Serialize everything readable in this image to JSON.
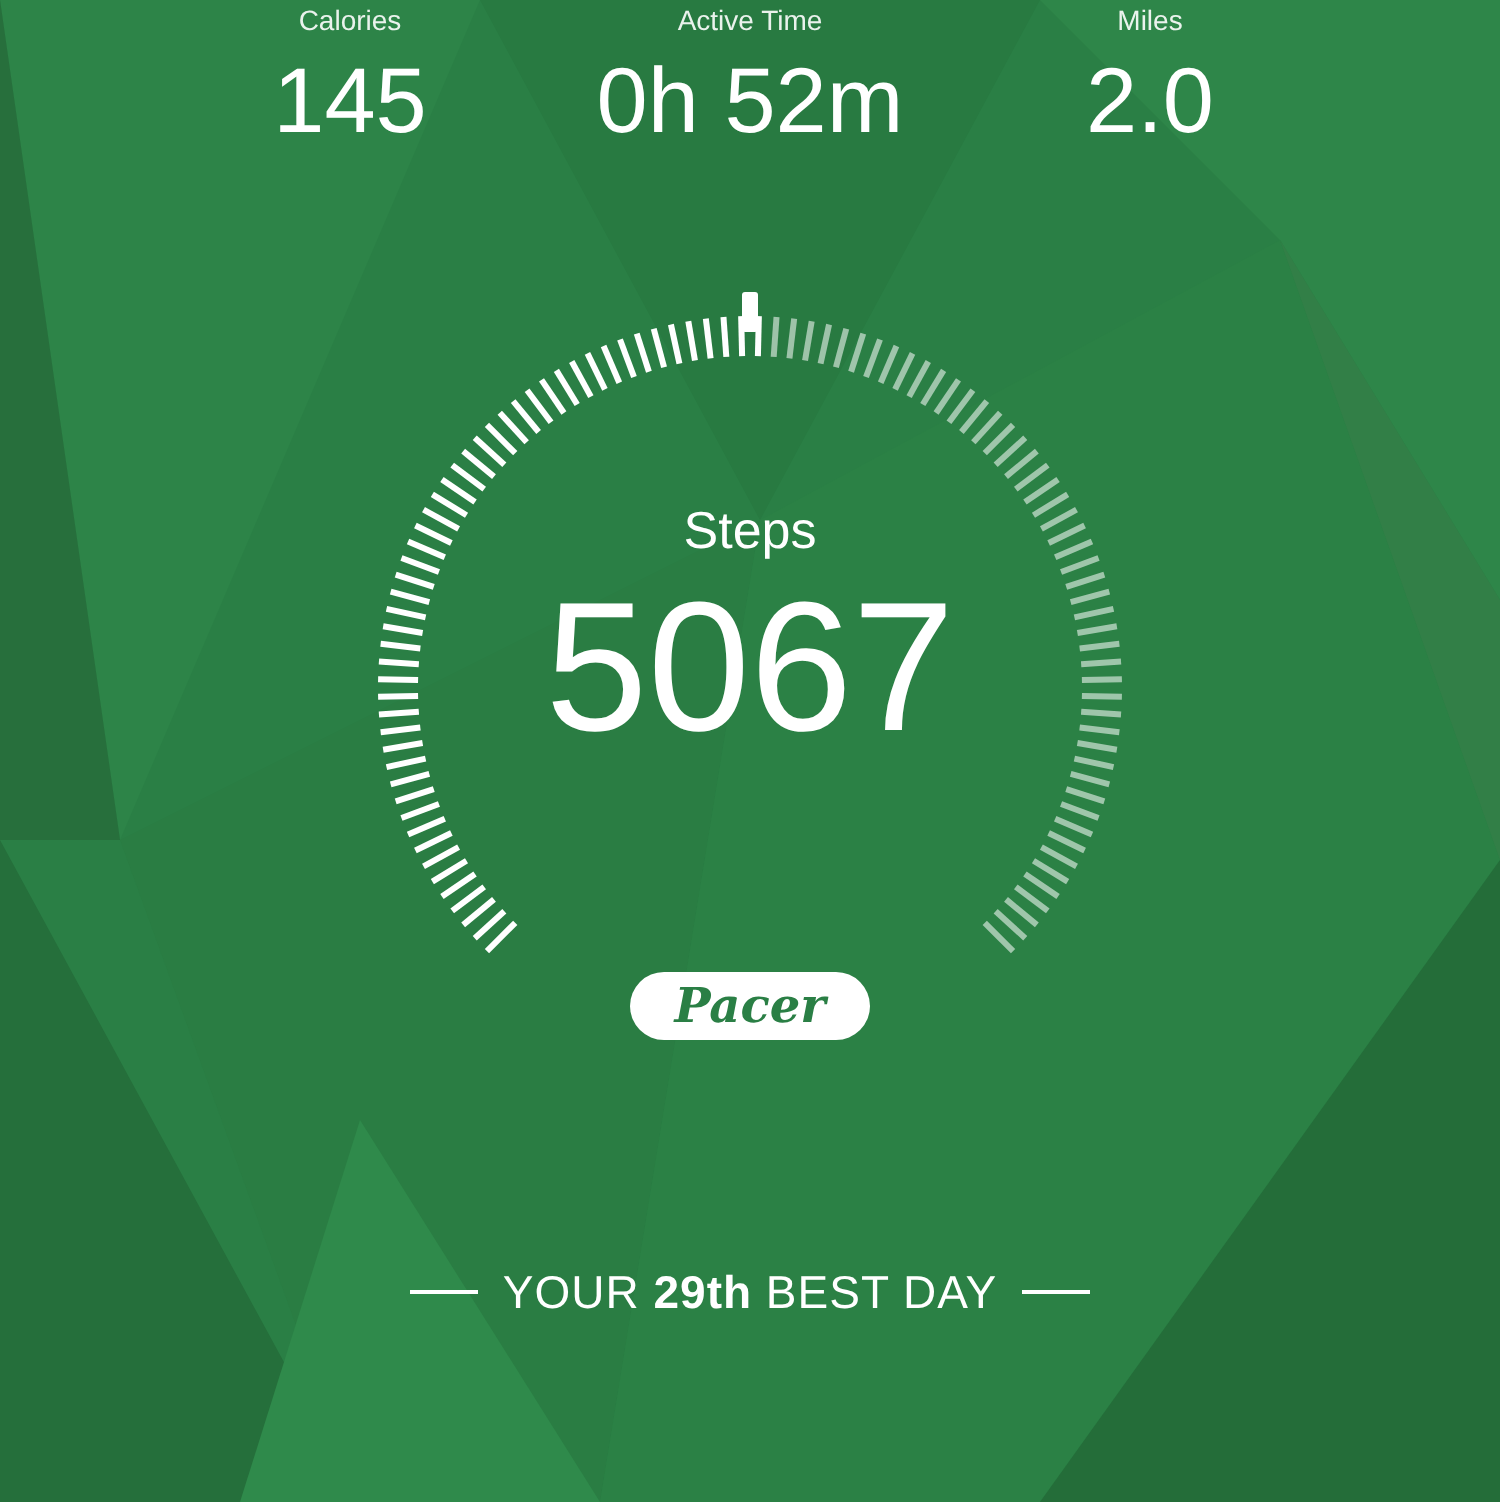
{
  "stats": [
    {
      "label": "Calories",
      "value": "145"
    },
    {
      "label": "Active Time",
      "value": "0h 52m"
    },
    {
      "label": "Miles",
      "value": "2.0"
    }
  ],
  "gauge": {
    "label": "Steps",
    "value": "5067"
  },
  "logo": {
    "text": "Pacer"
  },
  "footer": {
    "text": "YOUR **29th** BEST DAY"
  }
}
